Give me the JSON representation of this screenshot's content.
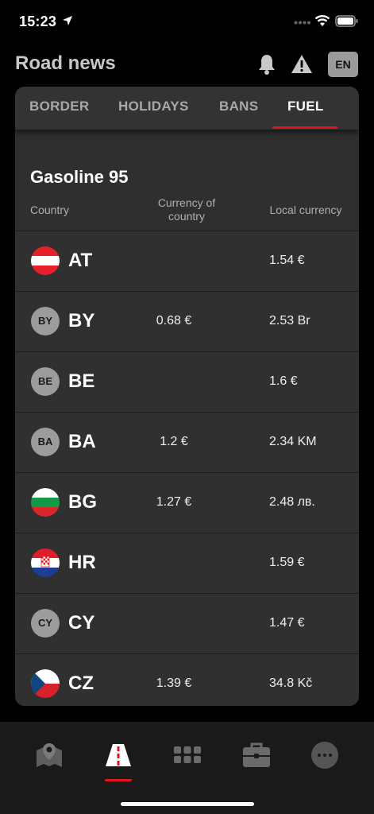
{
  "status_bar": {
    "time": "15:23"
  },
  "header": {
    "title": "Road news",
    "lang": "EN"
  },
  "tabs": [
    {
      "label": "BORDER",
      "active": false
    },
    {
      "label": "HOLIDAYS",
      "active": false
    },
    {
      "label": "BANS",
      "active": false
    },
    {
      "label": "FUEL",
      "active": true
    }
  ],
  "fuel": {
    "title": "Gasoline 95",
    "columns": {
      "country": "Country",
      "currency_of_country": "Currency of country",
      "local_currency": "Local currency"
    },
    "rows": [
      {
        "code": "AT",
        "flag": "austria-flag",
        "currency_of_country": "",
        "local": "1.54 €"
      },
      {
        "code": "BY",
        "badge": "BY",
        "currency_of_country": "0.68 €",
        "local": "2.53 Br"
      },
      {
        "code": "BE",
        "badge": "BE",
        "currency_of_country": "",
        "local": "1.6 €"
      },
      {
        "code": "BA",
        "badge": "BA",
        "currency_of_country": "1.2 €",
        "local": "2.34 KM"
      },
      {
        "code": "BG",
        "flag": "bulgaria-flag",
        "currency_of_country": "1.27 €",
        "local": "2.48 лв."
      },
      {
        "code": "HR",
        "flag": "croatia-flag",
        "currency_of_country": "",
        "local": "1.59 €"
      },
      {
        "code": "CY",
        "badge": "CY",
        "currency_of_country": "",
        "local": "1.47 €"
      },
      {
        "code": "CZ",
        "flag": "czech-flag",
        "currency_of_country": "1.39 €",
        "local": "34.8 Kč"
      }
    ]
  },
  "bottom_nav": [
    {
      "icon": "map-icon",
      "active": false
    },
    {
      "icon": "road-icon",
      "active": true
    },
    {
      "icon": "grid-icon",
      "active": false
    },
    {
      "icon": "briefcase-icon",
      "active": false
    },
    {
      "icon": "more-icon",
      "active": false
    }
  ],
  "colors": {
    "accent": "#e0141e",
    "card": "#2f2f2f",
    "background": "#000000"
  }
}
